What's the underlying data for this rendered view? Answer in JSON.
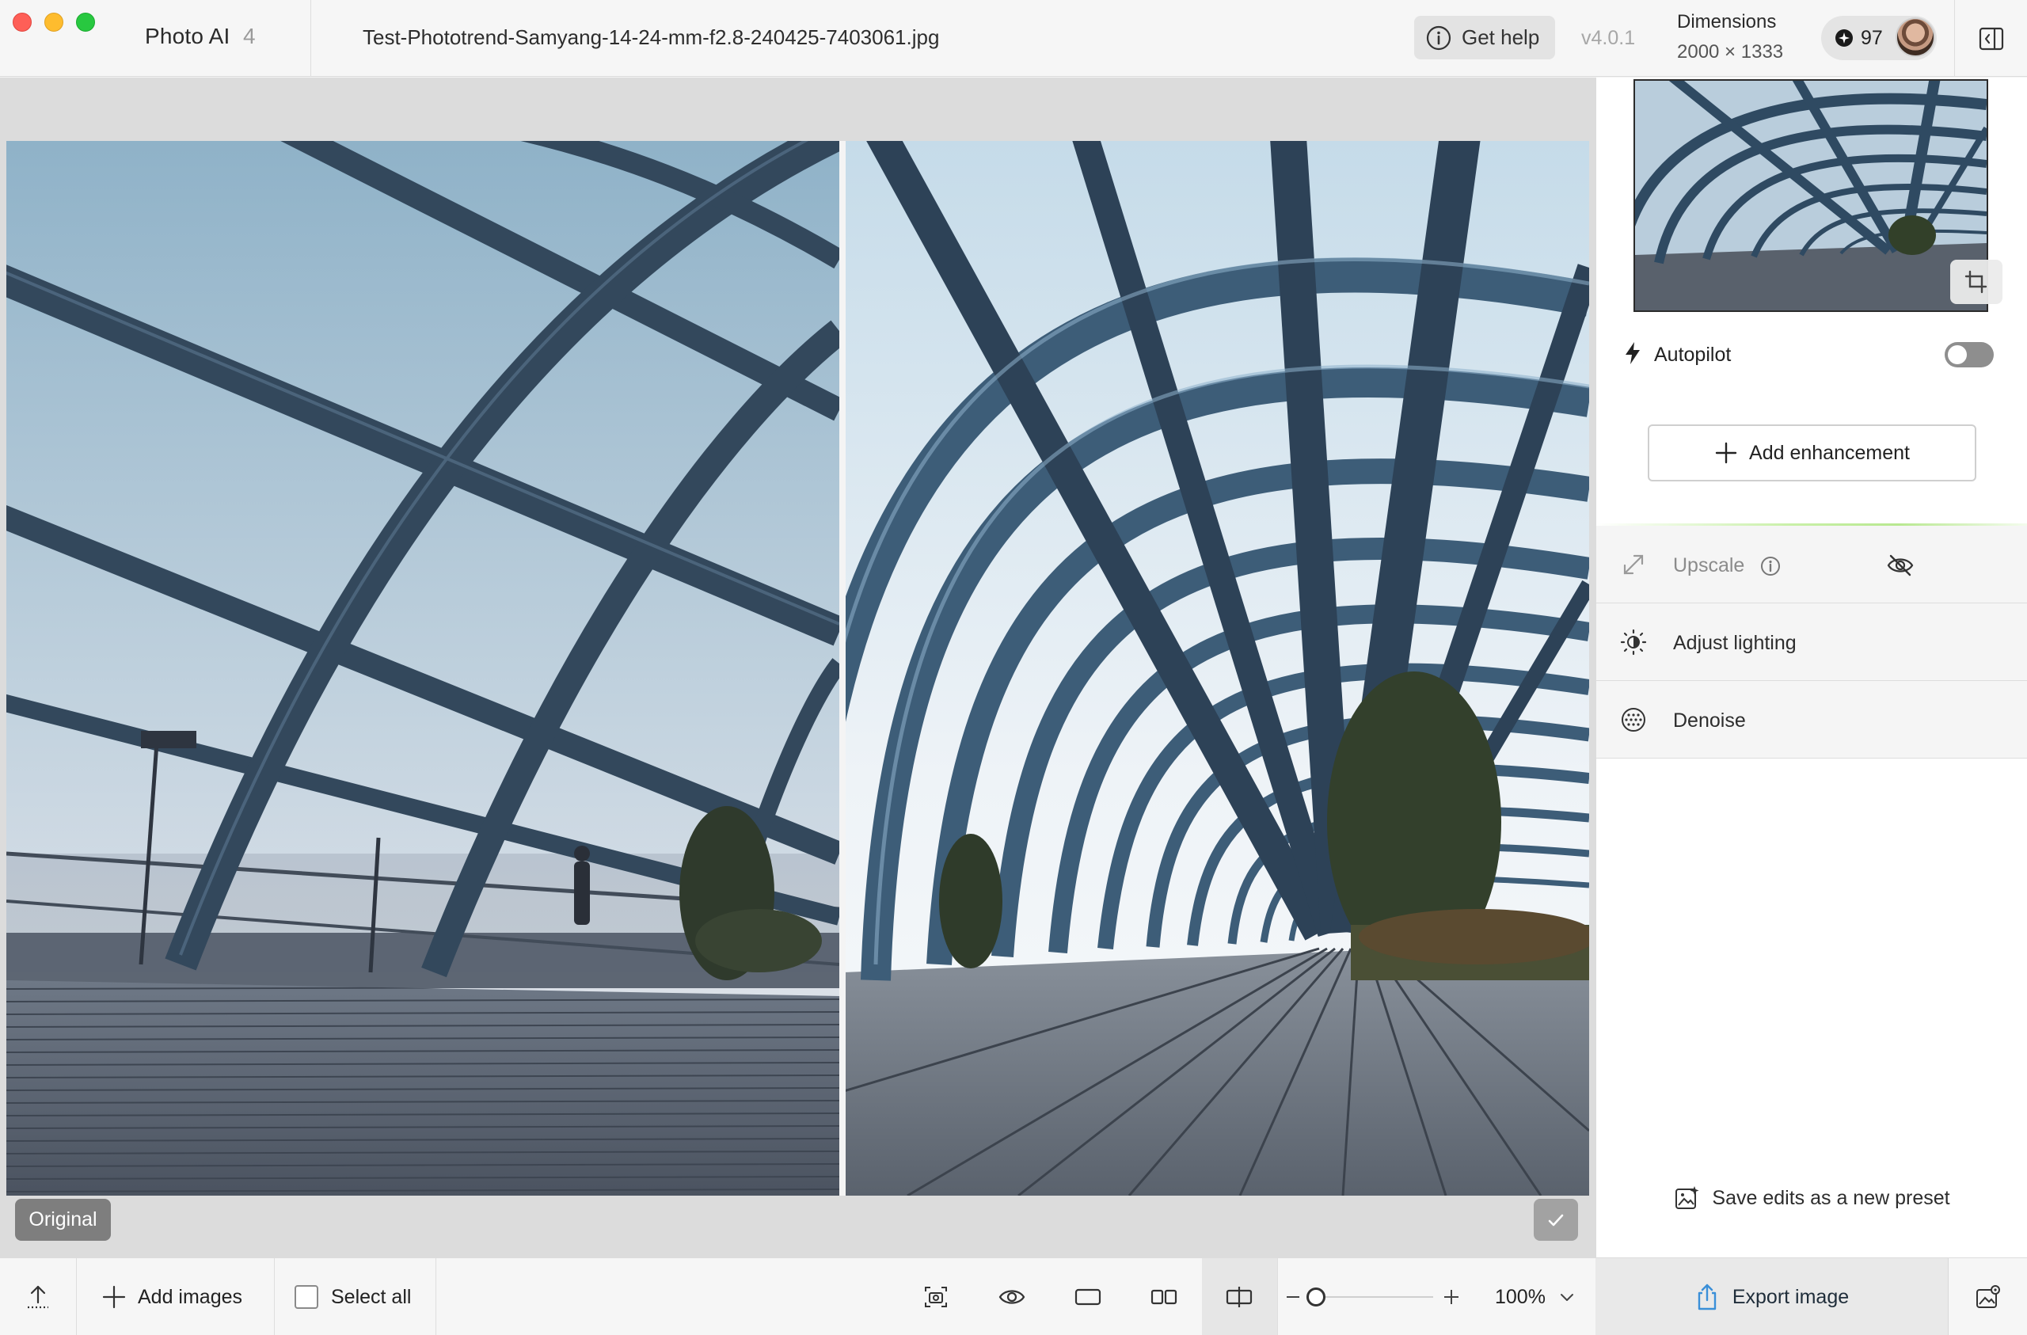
{
  "titlebar": {
    "app_name": "Photo AI",
    "app_version": "4",
    "file_name": "Test-Phototrend-Samyang-14-24-mm-f2.8-240425-7403061.jpg",
    "help_label": "Get help",
    "version": "v4.0.1",
    "dimensions_title": "Dimensions",
    "dimensions_value": "2000 × 1333",
    "credits": "97"
  },
  "canvas": {
    "original_label": "Original"
  },
  "side_panel": {
    "autopilot_label": "Autopilot",
    "autopilot_enabled": false,
    "add_enhancement_label": "Add enhancement",
    "enhancements": [
      {
        "label": "Upscale",
        "icon": "expand-arrows-icon",
        "disabled": true
      },
      {
        "label": "Adjust lighting",
        "icon": "sun-icon",
        "disabled": false
      },
      {
        "label": "Denoise",
        "icon": "grain-circle-icon",
        "disabled": false
      }
    ],
    "save_preset_label": "Save edits as a new preset"
  },
  "bottom_bar": {
    "add_images_label": "Add images",
    "select_all_label": "Select all",
    "zoom_value": "100%",
    "export_label": "Export image"
  },
  "colors": {
    "accent_export": "#3a8fd8",
    "toggle_off": "#8e8e8e",
    "traffic_close": "#fe5f57",
    "traffic_min": "#febc2e",
    "traffic_max": "#28c840"
  }
}
